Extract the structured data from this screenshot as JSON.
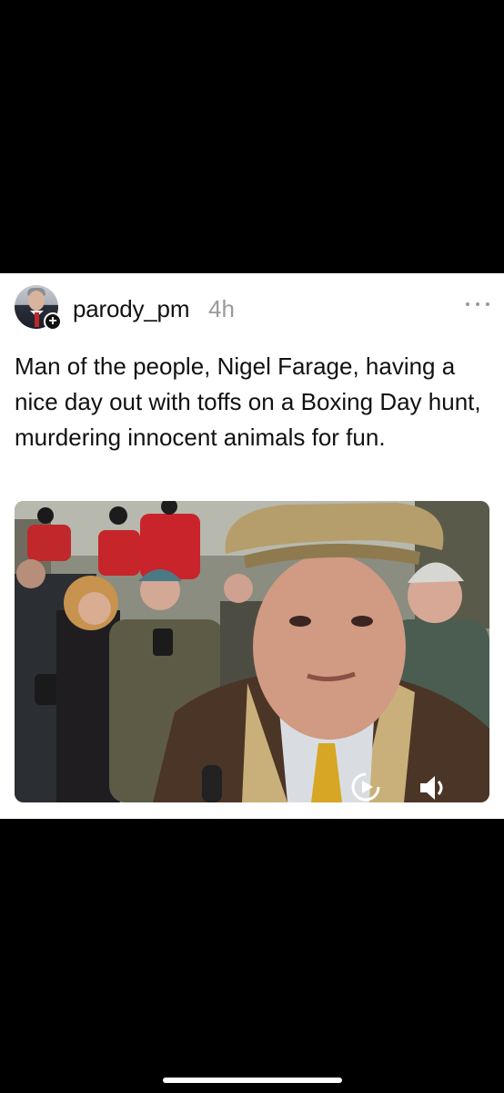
{
  "post": {
    "username": "parody_pm",
    "timestamp": "4h",
    "follow_symbol": "+",
    "text": "Man of the people, Nigel Farage, having a nice day out with toffs on a Boxing Day hunt, murdering innocent animals for fun.",
    "more_icon": "more-horizontal-icon"
  },
  "media": {
    "type": "video",
    "controls": {
      "replay_icon": "replay-icon",
      "mute_icon": "speaker-icon"
    }
  },
  "colors": {
    "background": "#000000",
    "card": "#ffffff",
    "text": "#111111",
    "muted": "#9a9a9a"
  }
}
